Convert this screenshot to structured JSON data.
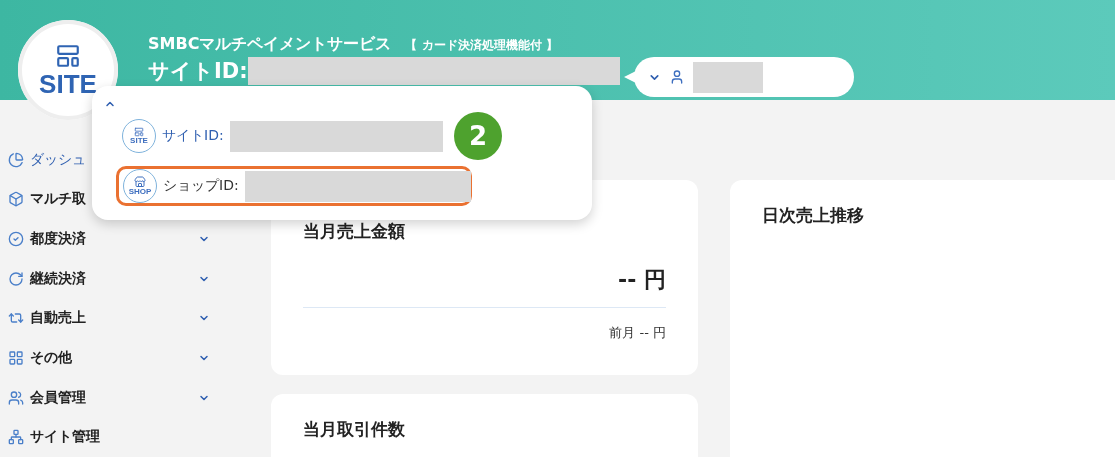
{
  "header": {
    "service_name": "SMBCマルチペイメントサービス",
    "service_note": "【 カード決済処理機能付 】",
    "site_id_label": "サイトID:",
    "logo_text": "SITE"
  },
  "site_menu": {
    "open": true,
    "step_badge": "2",
    "items": [
      {
        "kind": "site",
        "label": "サイトID:",
        "icon_text": "SITE",
        "highlighted": false
      },
      {
        "kind": "shop",
        "label": "ショップID:",
        "icon_text": "SHOP",
        "highlighted": true
      }
    ]
  },
  "sidebar": {
    "items": [
      {
        "kind": "dashboard",
        "label": "ダッシュ",
        "selected": true,
        "expandable": false
      },
      {
        "kind": "box",
        "label": "マルチ取",
        "selected": false,
        "expandable": false
      },
      {
        "kind": "check",
        "label": "都度決済",
        "selected": false,
        "expandable": true
      },
      {
        "kind": "recurring",
        "label": "継続決済",
        "selected": false,
        "expandable": true
      },
      {
        "kind": "repeat",
        "label": "自動売上",
        "selected": false,
        "expandable": true
      },
      {
        "kind": "grid",
        "label": "その他",
        "selected": false,
        "expandable": true
      },
      {
        "kind": "users",
        "label": "会員管理",
        "selected": false,
        "expandable": true
      },
      {
        "kind": "network",
        "label": "サイト管理",
        "selected": false,
        "expandable": false
      }
    ]
  },
  "cards": [
    {
      "title": "当月売上金額",
      "value": "-- 円",
      "previous": "前月 -- 円"
    },
    {
      "title": "当月取引件数"
    },
    {
      "title": "日次売上推移"
    }
  ]
}
